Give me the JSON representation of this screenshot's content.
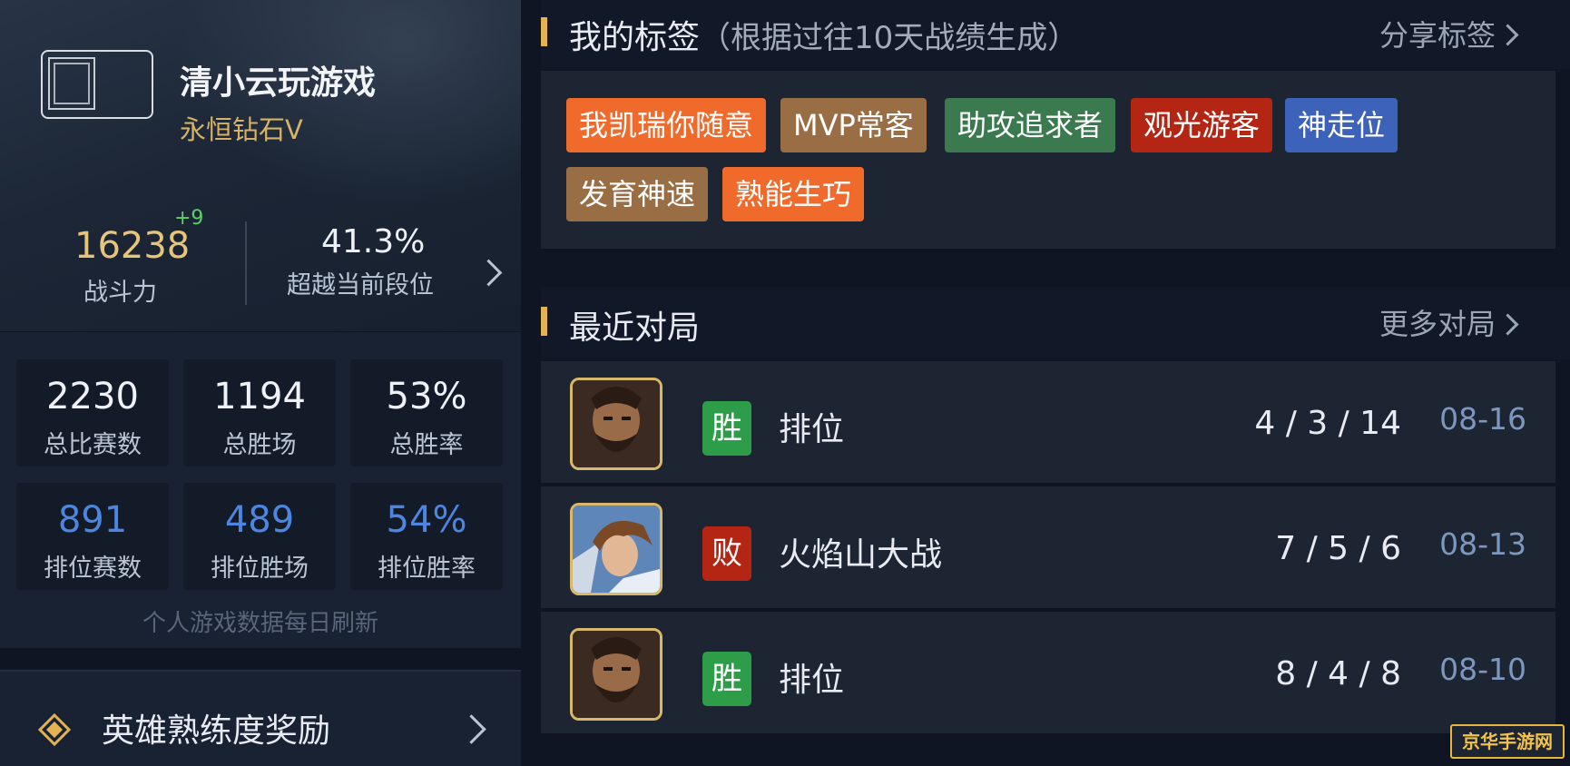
{
  "profile": {
    "nickname": "清小云玩游戏",
    "rank": "永恒钻石V",
    "power_value": "16238",
    "power_delta": "+9",
    "power_label": "战斗力",
    "surpass_value": "41.3%",
    "surpass_label": "超越当前段位"
  },
  "stats": [
    {
      "value": "2230",
      "label": "总比赛数"
    },
    {
      "value": "1194",
      "label": "总胜场"
    },
    {
      "value": "53%",
      "label": "总胜率"
    },
    {
      "value": "891",
      "label": "排位赛数"
    },
    {
      "value": "489",
      "label": "排位胜场"
    },
    {
      "value": "54%",
      "label": "排位胜率"
    }
  ],
  "stats_footer": "个人游戏数据每日刷新",
  "reward": {
    "label": "英雄熟练度奖励"
  },
  "tags_section": {
    "title": "我的标签",
    "subtitle": "（根据过往10天战绩生成）",
    "share_label": "分享标签",
    "tags": [
      {
        "text": "我凯瑞你随意",
        "color": "#f06a2c"
      },
      {
        "text": "MVP常客",
        "color": "#9a6e45"
      },
      {
        "text": "助攻追求者",
        "color": "#3b7a4f"
      },
      {
        "text": "观光游客",
        "color": "#b42513"
      },
      {
        "text": "神走位",
        "color": "#3d62ba"
      },
      {
        "text": "发育神速",
        "color": "#9a6e45"
      },
      {
        "text": "熟能生巧",
        "color": "#f06a2c"
      }
    ]
  },
  "matches_section": {
    "title": "最近对局",
    "more_label": "更多对局",
    "matches": [
      {
        "result": "胜",
        "result_color": "#2e9d4a",
        "mode": "排位",
        "kda": "4 / 3 / 14",
        "date": "08-16",
        "hero_icon": "bearded-warrior-hero"
      },
      {
        "result": "败",
        "result_color": "#b42513",
        "mode": "火焰山大战",
        "kda": "7 / 5 / 6",
        "date": "08-13",
        "hero_icon": "brown-haired-hero"
      },
      {
        "result": "胜",
        "result_color": "#2e9d4a",
        "mode": "排位",
        "kda": "8 / 4 / 8",
        "date": "08-10",
        "hero_icon": "bearded-warrior-hero"
      }
    ]
  },
  "watermark": "京华手游网"
}
